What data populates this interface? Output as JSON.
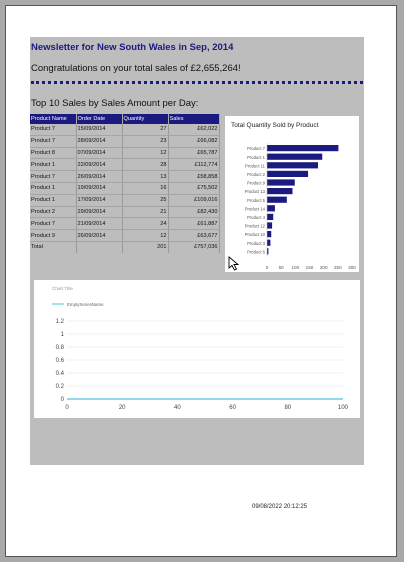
{
  "report": {
    "title": "Newsletter for New South Wales in Sep, 2014",
    "congrats": "Congratulations on your total sales of £2,655,264!",
    "top10_heading": "Top 10 Sales by Sales Amount per Day:",
    "timestamp": "09/08/2022 20:12:25"
  },
  "table": {
    "headers": [
      "Product Name",
      "Order Date",
      "Quantity",
      "Sales"
    ],
    "rows": [
      [
        "Product 7",
        "15/09/2014",
        "27",
        "£62,022"
      ],
      [
        "Product 7",
        "28/09/2014",
        "23",
        "£66,082"
      ],
      [
        "Product 8",
        "07/09/2014",
        "12",
        "£65,787"
      ],
      [
        "Product 1",
        "22/09/2014",
        "28",
        "£112,774"
      ],
      [
        "Product 7",
        "26/09/2014",
        "13",
        "£58,858"
      ],
      [
        "Product 1",
        "19/09/2014",
        "16",
        "£75,502"
      ],
      [
        "Product 1",
        "17/09/2014",
        "25",
        "£109,016"
      ],
      [
        "Product 2",
        "29/09/2014",
        "21",
        "£82,430"
      ],
      [
        "Product 7",
        "21/09/2014",
        "24",
        "£61,887"
      ],
      [
        "Product 9",
        "26/09/2014",
        "12",
        "£63,677"
      ]
    ],
    "total": [
      "Total",
      "",
      "201",
      "£757,036"
    ]
  },
  "colors": {
    "navy": "#1a1a80",
    "line": "#4fc3d9",
    "band": "#bdbdbd"
  },
  "chart_data": [
    {
      "type": "bar",
      "orientation": "horizontal",
      "title": "Total Quantity Sold by Product",
      "categories": [
        "Product 7",
        "Product 1",
        "Product 11",
        "Product 2",
        "Product 9",
        "Product 13",
        "Product 5",
        "Product 14",
        "Product 4",
        "Product 12",
        "Product 10",
        "Product 3",
        "Product 6"
      ],
      "values": [
        252,
        195,
        180,
        145,
        98,
        90,
        70,
        28,
        22,
        18,
        15,
        12,
        5
      ],
      "xlim": [
        0,
        300
      ],
      "xticks": [
        "0",
        "50",
        "100",
        "150",
        "200",
        "250",
        "300"
      ]
    },
    {
      "type": "line",
      "title": "Chart Title",
      "series": [
        {
          "name": "EmptySeriesName",
          "x": [
            0,
            100
          ],
          "y": [
            0,
            0
          ]
        }
      ],
      "xlim": [
        0,
        100
      ],
      "ylim": [
        0,
        1.2
      ],
      "xticks": [
        "0",
        "20",
        "40",
        "60",
        "80",
        "100"
      ],
      "yticks": [
        "0",
        "0.2",
        "0.4",
        "0.6",
        "0.8",
        "1",
        "1.2"
      ],
      "grid": true,
      "legend": "top-left"
    }
  ]
}
